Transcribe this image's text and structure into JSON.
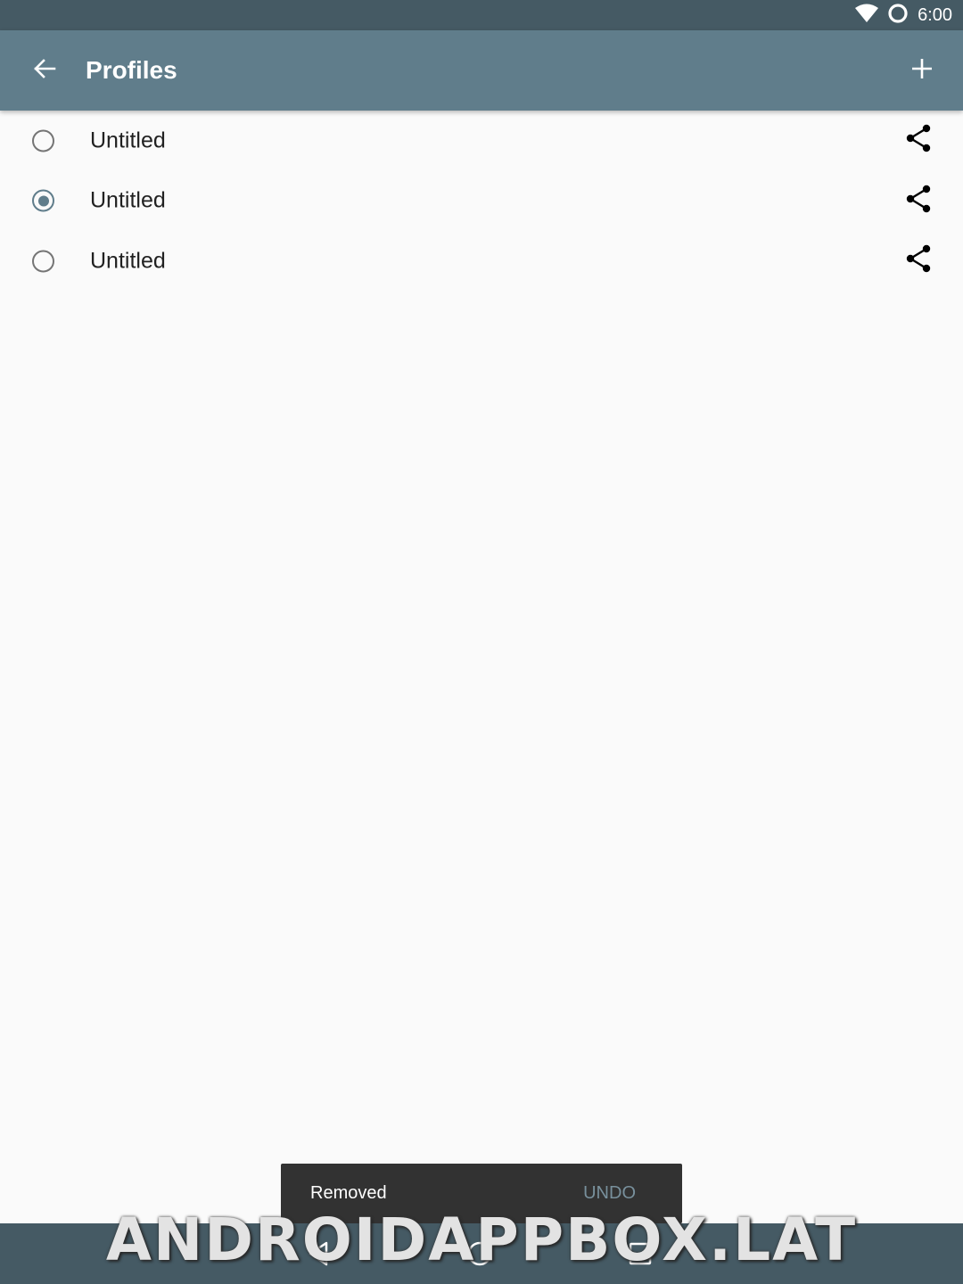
{
  "status_bar": {
    "time": "6:00",
    "icons": [
      "wifi-icon",
      "sync-circle-icon"
    ]
  },
  "toolbar": {
    "title": "Profiles",
    "back_icon": "arrow-back-icon",
    "add_icon": "plus-icon",
    "background": "#607d8b"
  },
  "profiles": [
    {
      "label": "Untitled",
      "selected": false
    },
    {
      "label": "Untitled",
      "selected": true
    },
    {
      "label": "Untitled",
      "selected": false
    }
  ],
  "snackbar": {
    "message": "Removed",
    "action": "UNDO"
  },
  "watermark": "ANDROIDAPPBOX.LAT",
  "colors": {
    "accent": "#607d8b",
    "status_bar": "#455a64",
    "snackbar": "#323232",
    "snackbar_action": "#78909c"
  }
}
